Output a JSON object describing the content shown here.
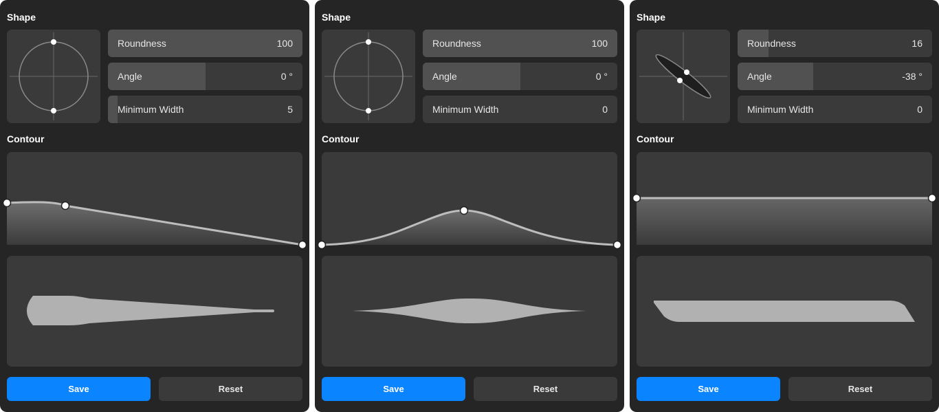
{
  "panels": [
    {
      "shape_title": "Shape",
      "contour_title": "Contour",
      "sliders": {
        "roundness": {
          "label": "Roundness",
          "value": "100",
          "fill": 1.0
        },
        "angle": {
          "label": "Angle",
          "value": "0 °",
          "fill": 0.5
        },
        "min_width": {
          "label": "Minimum Width",
          "value": "5",
          "fill": 0.05
        }
      },
      "buttons": {
        "save": "Save",
        "reset": "Reset"
      }
    },
    {
      "shape_title": "Shape",
      "contour_title": "Contour",
      "sliders": {
        "roundness": {
          "label": "Roundness",
          "value": "100",
          "fill": 1.0
        },
        "angle": {
          "label": "Angle",
          "value": "0 °",
          "fill": 0.5
        },
        "min_width": {
          "label": "Minimum Width",
          "value": "0",
          "fill": 0.0
        }
      },
      "buttons": {
        "save": "Save",
        "reset": "Reset"
      }
    },
    {
      "shape_title": "Shape",
      "contour_title": "Contour",
      "sliders": {
        "roundness": {
          "label": "Roundness",
          "value": "16",
          "fill": 0.16
        },
        "angle": {
          "label": "Angle",
          "value": "-38 °",
          "fill": 0.39
        },
        "min_width": {
          "label": "Minimum Width",
          "value": "0",
          "fill": 0.0
        }
      },
      "buttons": {
        "save": "Save",
        "reset": "Reset"
      }
    }
  ],
  "colors": {
    "panel_bg": "#252526",
    "control_bg": "#3a3a3b",
    "slider_fill": "#515152",
    "accent": "#0a84ff",
    "stroke_shape": "#b3b3b3"
  }
}
